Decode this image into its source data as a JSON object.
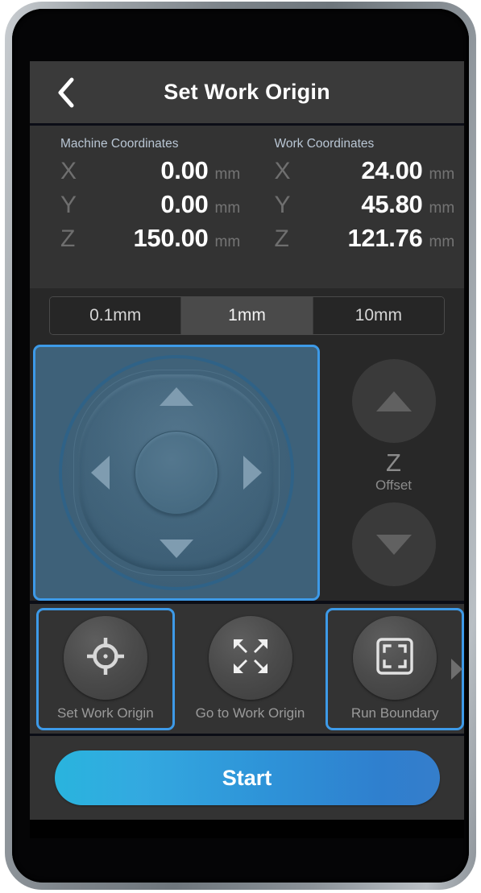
{
  "header": {
    "title": "Set Work Origin",
    "back_icon": "chevron-left-icon"
  },
  "coordinates": {
    "machine": {
      "heading": "Machine Coordinates",
      "rows": [
        {
          "axis": "X",
          "value": "0.00",
          "unit": "mm"
        },
        {
          "axis": "Y",
          "value": "0.00",
          "unit": "mm"
        },
        {
          "axis": "Z",
          "value": "150.00",
          "unit": "mm"
        }
      ]
    },
    "work": {
      "heading": "Work Coordinates",
      "rows": [
        {
          "axis": "X",
          "value": "24.00",
          "unit": "mm"
        },
        {
          "axis": "Y",
          "value": "45.80",
          "unit": "mm"
        },
        {
          "axis": "Z",
          "value": "121.76",
          "unit": "mm"
        }
      ]
    }
  },
  "step_selector": {
    "options": [
      "0.1mm",
      "1mm",
      "10mm"
    ],
    "selected": "1mm"
  },
  "jog": {
    "dpad": {
      "name": "xy-jog-pad",
      "up_icon": "arrow-up-icon",
      "down_icon": "arrow-down-icon",
      "left_icon": "arrow-left-icon",
      "right_icon": "arrow-right-icon",
      "center_icon": "home-center-icon",
      "focused": true
    },
    "z_offset": {
      "letter": "Z",
      "sublabel": "Offset",
      "up_icon": "triangle-up-icon",
      "down_icon": "triangle-down-icon"
    }
  },
  "actions": [
    {
      "label": "Set Work Origin",
      "icon": "crosshair-target-icon",
      "focused": true
    },
    {
      "label": "Go to Work Origin",
      "icon": "converge-arrows-icon",
      "focused": false
    },
    {
      "label": "Run Boundary",
      "icon": "boundary-frame-icon",
      "focused": true
    }
  ],
  "next_chevron_icon": "chevron-right-icon",
  "start": {
    "label": "Start"
  },
  "colors": {
    "accent_blue": "#3d9ae8",
    "panel_blue": "#3e6179",
    "start_gradient_from": "#29b4de",
    "start_gradient_to": "#357ecb",
    "screen_bg": "#282828",
    "titlebar_bg": "#3a3a3a"
  }
}
